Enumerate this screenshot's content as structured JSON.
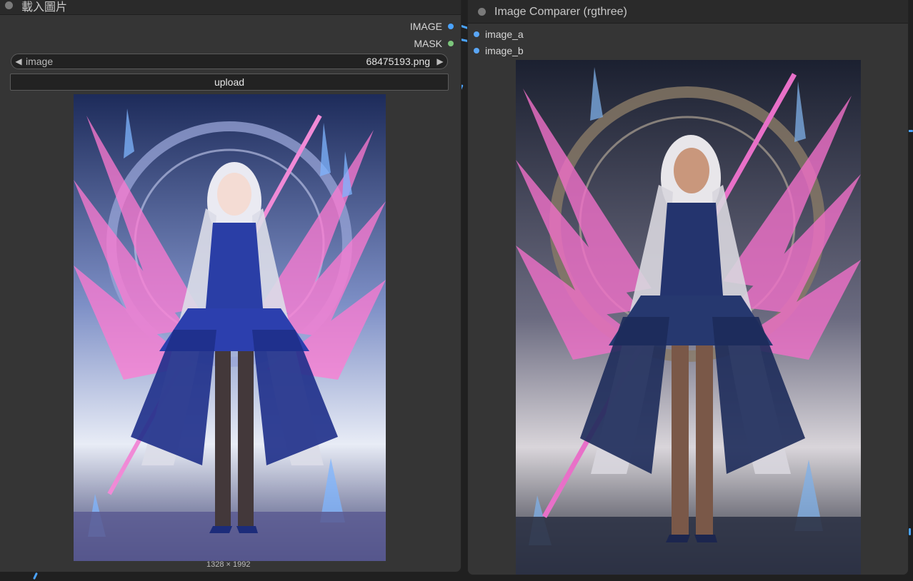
{
  "load_node": {
    "title": "載入圖片",
    "outputs": [
      {
        "label": "IMAGE",
        "color": "#4aa3ff"
      },
      {
        "label": "MASK",
        "color": "#7cc67c"
      }
    ],
    "image_widget": {
      "label": "image",
      "value": "68475193.png"
    },
    "upload_label": "upload",
    "image_size": "1328 × 1992"
  },
  "compare_node": {
    "title": "Image Comparer (rgthree)",
    "inputs": [
      {
        "label": "image_a"
      },
      {
        "label": "image_b"
      }
    ]
  },
  "colors": {
    "node_bg": "#353535",
    "title_bg": "#2a2a2a",
    "wire_blue": "#4aa3ff",
    "mask_green": "#7cc67c"
  }
}
